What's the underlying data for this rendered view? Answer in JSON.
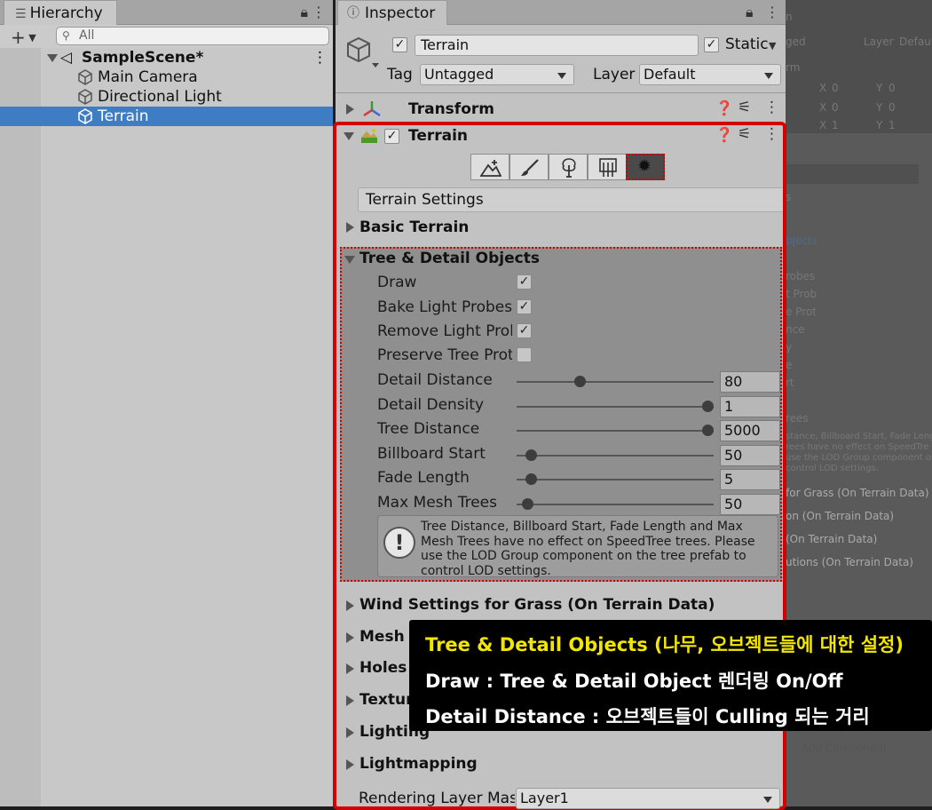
{
  "hierarchy": {
    "tab_label": "Hierarchy",
    "search_placeholder": "All",
    "scene_name": "SampleScene*",
    "objects": [
      "Main Camera",
      "Directional Light",
      "Terrain"
    ]
  },
  "inspector": {
    "tab_label": "Inspector",
    "object_name": "Terrain",
    "static_label": "Static",
    "tag_label": "Tag",
    "tag_value": "Untagged",
    "layer_label": "Layer",
    "layer_value": "Default",
    "components": {
      "transform": "Transform",
      "terrain": "Terrain"
    },
    "terrain_settings_header": "Terrain Settings",
    "sections": {
      "basic_terrain": "Basic Terrain",
      "tree_detail": "Tree & Detail Objects",
      "wind": "Wind Settings for Grass (On Terrain Data)",
      "mesh": "Mesh R",
      "holes": "Holes S",
      "texture": "Textur",
      "lighting": "Lighting",
      "lightmapping": "Lightmapping"
    },
    "tree_detail_toggles": [
      {
        "label": "Draw",
        "checked": true
      },
      {
        "label": "Bake Light Probes F",
        "checked": true
      },
      {
        "label": "Remove Light Prob",
        "checked": true
      },
      {
        "label": "Preserve Tree Proto",
        "checked": false
      }
    ],
    "sliders": [
      {
        "label": "Detail Distance",
        "value": "80",
        "fraction": 0.31
      },
      {
        "label": "Detail Density",
        "value": "1",
        "fraction": 1.0
      },
      {
        "label": "Tree Distance",
        "value": "5000",
        "fraction": 1.0
      },
      {
        "label": "Billboard Start",
        "value": "50",
        "fraction": 0.05
      },
      {
        "label": "Fade Length",
        "value": "5",
        "fraction": 0.05
      },
      {
        "label": "Max Mesh Trees",
        "value": "50",
        "fraction": 0.03
      }
    ],
    "help_text": "Tree Distance, Billboard Start, Fade Length and Max Mesh Trees have no effect on SpeedTree trees. Please use the LOD Group component on the tree prefab to control LOD settings.",
    "rendering_layer_label": "Rendering Layer Masl",
    "rendering_layer_value": "Layer1"
  },
  "caption": {
    "line1": "Tree & Detail Objects (나무, 오브젝트들에 대한 설정)",
    "line2": "Draw : Tree & Detail Object 렌더링 On/Off",
    "line3": "Detail Distance : 오브젝트들이 Culling 되는 거리"
  },
  "background_panel": {
    "texts": [
      "ged",
      "Layer",
      "Defaul",
      "rm",
      "X",
      "0",
      "Y",
      "0",
      "X",
      "0",
      "Y",
      "0",
      "X",
      "1",
      "Y",
      "1",
      "s",
      "bjects",
      "robes",
      "t Prob",
      "e Prot",
      "nce",
      "y",
      "e",
      "rt",
      "rees",
      "stance, Billboard Start, Fade Leng",
      "rees have no effect on SpeedTre",
      "use the LOD Group component on",
      "control LOD settings.",
      "for Grass (On Terrain Data)",
      "on (On Terrain Data)",
      "(On Terrain Data)",
      "utions (On Terrain Data)",
      "Add Component"
    ]
  },
  "colors": {
    "highlight_red": "#d40000",
    "selection_blue": "#3e7dc4",
    "caption_yellow": "#f2e600"
  }
}
